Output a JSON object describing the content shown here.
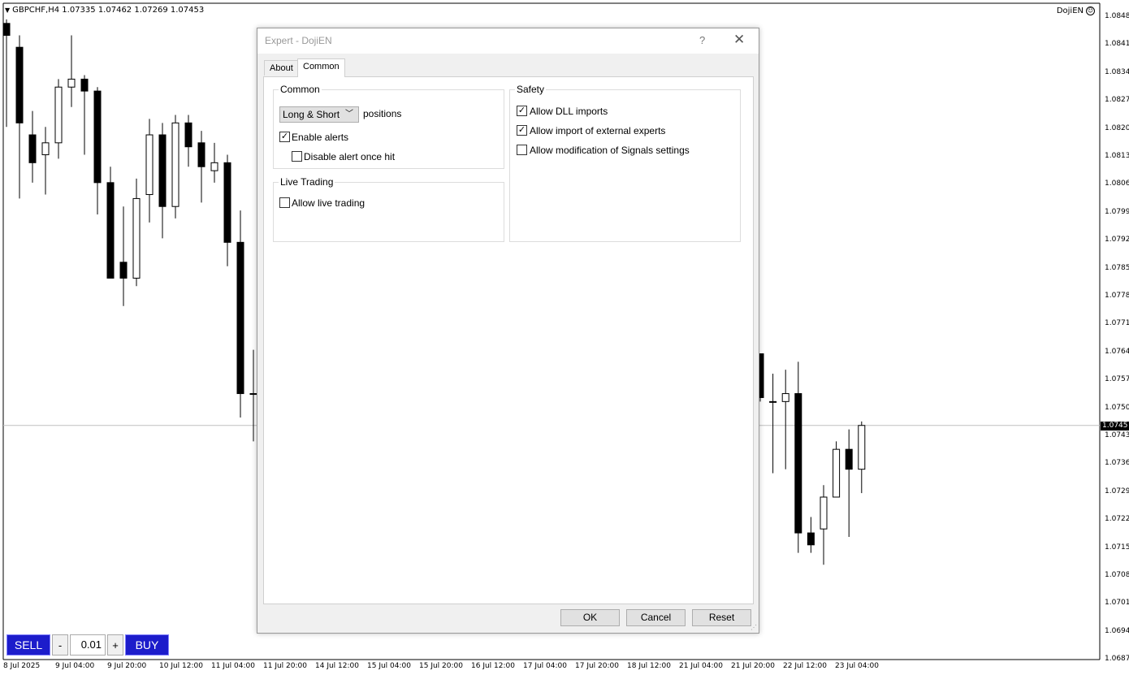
{
  "chart": {
    "symbol_info": "GBPCHF,H4  1.07335 1.07462 1.07269 1.07453",
    "ea_name": "DojiEN",
    "current_price": "1.0745",
    "price_labels": [
      "1.0848",
      "1.0841",
      "1.0834",
      "1.0827",
      "1.0820",
      "1.0813",
      "1.0806",
      "1.0799",
      "1.0792",
      "1.0785",
      "1.0778",
      "1.0771",
      "1.0764",
      "1.0757",
      "1.0750",
      "1.0743",
      "1.0736",
      "1.0729",
      "1.0722",
      "1.0715",
      "1.0708",
      "1.0701",
      "1.0694",
      "1.0687"
    ],
    "time_labels": [
      "8 Jul 2025",
      "9 Jul 04:00",
      "9 Jul 20:00",
      "10 Jul 12:00",
      "11 Jul 04:00",
      "11 Jul 20:00",
      "14 Jul 12:00",
      "15 Jul 04:00",
      "15 Jul 20:00",
      "16 Jul 12:00",
      "17 Jul 04:00",
      "17 Jul 20:00",
      "18 Jul 12:00",
      "21 Jul 04:00",
      "21 Jul 20:00",
      "22 Jul 12:00",
      "23 Jul 04:00"
    ],
    "candles_left": [
      {
        "o": 1.0846,
        "h": 1.0847,
        "l": 1.082,
        "c": 1.0843
      },
      {
        "o": 1.084,
        "h": 1.0843,
        "l": 1.0802,
        "c": 1.0821
      },
      {
        "o": 1.0818,
        "h": 1.0824,
        "l": 1.0806,
        "c": 1.0811
      },
      {
        "o": 1.0813,
        "h": 1.082,
        "l": 1.0803,
        "c": 1.0816
      },
      {
        "o": 1.0816,
        "h": 1.0832,
        "l": 1.0812,
        "c": 1.083
      },
      {
        "o": 1.083,
        "h": 1.0843,
        "l": 1.0825,
        "c": 1.0832
      },
      {
        "o": 1.0832,
        "h": 1.0833,
        "l": 1.0813,
        "c": 1.0829
      },
      {
        "o": 1.0829,
        "h": 1.083,
        "l": 1.0798,
        "c": 1.0806
      },
      {
        "o": 1.0806,
        "h": 1.081,
        "l": 1.079,
        "c": 1.0782
      },
      {
        "o": 1.0786,
        "h": 1.08,
        "l": 1.0775,
        "c": 1.0782
      },
      {
        "o": 1.0782,
        "h": 1.0807,
        "l": 1.078,
        "c": 1.0802
      },
      {
        "o": 1.0803,
        "h": 1.0822,
        "l": 1.0796,
        "c": 1.0818
      },
      {
        "o": 1.0818,
        "h": 1.0821,
        "l": 1.0792,
        "c": 1.08
      },
      {
        "o": 1.08,
        "h": 1.0823,
        "l": 1.0797,
        "c": 1.0821
      },
      {
        "o": 1.0821,
        "h": 1.0823,
        "l": 1.081,
        "c": 1.0815
      },
      {
        "o": 1.0816,
        "h": 1.0819,
        "l": 1.0801,
        "c": 1.081
      },
      {
        "o": 1.0809,
        "h": 1.0816,
        "l": 1.0806,
        "c": 1.0811
      },
      {
        "o": 1.0811,
        "h": 1.0813,
        "l": 1.0785,
        "c": 1.0791
      },
      {
        "o": 1.0791,
        "h": 1.0799,
        "l": 1.0747,
        "c": 1.0753
      },
      {
        "o": 1.0753,
        "h": 1.0764,
        "l": 1.0741,
        "c": 1.0753
      }
    ],
    "candles_right": [
      {
        "o": 1.0763,
        "h": 1.0763,
        "l": 1.0751,
        "c": 1.0752
      },
      {
        "o": 1.0751,
        "h": 1.0758,
        "l": 1.0733,
        "c": 1.0751
      },
      {
        "o": 1.0751,
        "h": 1.0759,
        "l": 1.0734,
        "c": 1.0753
      },
      {
        "o": 1.0753,
        "h": 1.0761,
        "l": 1.0713,
        "c": 1.0718
      },
      {
        "o": 1.0718,
        "h": 1.0722,
        "l": 1.0713,
        "c": 1.0715
      },
      {
        "o": 1.0719,
        "h": 1.073,
        "l": 1.071,
        "c": 1.0727
      },
      {
        "o": 1.0727,
        "h": 1.0741,
        "l": 1.0727,
        "c": 1.0739
      },
      {
        "o": 1.0739,
        "h": 1.0744,
        "l": 1.0717,
        "c": 1.0734
      },
      {
        "o": 1.0734,
        "h": 1.0746,
        "l": 1.0728,
        "c": 1.0745
      }
    ]
  },
  "trade_panel": {
    "sell_label": "SELL",
    "minus_label": "-",
    "lot_value": "0.01",
    "plus_label": "+",
    "buy_label": "BUY"
  },
  "dialog": {
    "title": "Expert - DojiEN",
    "help": "?",
    "close": "✕",
    "tabs": [
      {
        "label": "About"
      },
      {
        "label": "Common"
      }
    ],
    "common_group": {
      "title": "Common",
      "positions_select": "Long & Short",
      "positions_label": "positions",
      "enable_alerts": {
        "label": "Enable alerts",
        "checked": true
      },
      "disable_alert_once": {
        "label": "Disable alert once hit",
        "checked": false
      }
    },
    "live_group": {
      "title": "Live Trading",
      "allow_live": {
        "label": "Allow live trading",
        "checked": false
      }
    },
    "safety_group": {
      "title": "Safety",
      "allow_dll": {
        "label": "Allow DLL imports",
        "checked": true
      },
      "allow_import": {
        "label": "Allow import of external experts",
        "checked": true
      },
      "allow_signals": {
        "label": "Allow modification of Signals settings",
        "checked": false
      }
    },
    "buttons": {
      "ok": "OK",
      "cancel": "Cancel",
      "reset": "Reset"
    }
  }
}
